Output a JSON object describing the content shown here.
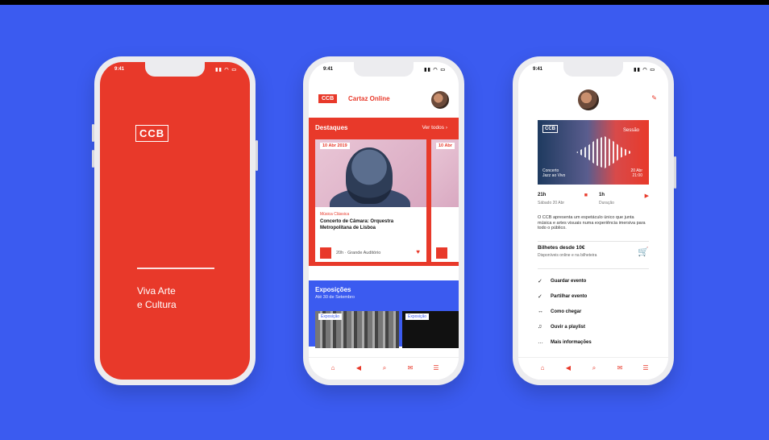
{
  "phone1": {
    "time": "9:41",
    "status_icons": "▮▮ ◠ ▭",
    "logo": "CCB",
    "tagline_line1": "Viva Arte",
    "tagline_line2": "e Cultura"
  },
  "phone2": {
    "time": "9:41",
    "status_icons": "▮▮ ◠ ▭",
    "logo": "CCB",
    "header_title": "Cartaz Online",
    "band_title": "Destaques",
    "band_link": "Ver todos ›",
    "card": {
      "date": "10 Abr 2019",
      "category": "Música Clássica",
      "title": "Concerto de Câmara: Orquestra Metropolitana de Lisboa",
      "footer": "20h · Grande Auditório",
      "heart": "♥"
    },
    "card2_date": "10 Abr",
    "blue_title": "Exposições",
    "blue_sub": "Até 30 de Setembro",
    "photo_tag": "Exposição",
    "photo_tag2": "Exposição",
    "tabs": [
      "⌂",
      "◀",
      "⌕",
      "✉",
      "☰"
    ]
  },
  "phone3": {
    "time": "9:41",
    "status_icons": "▮▮ ◠ ▭",
    "ticket_icon": "✎",
    "hero": {
      "logo": "CCB",
      "right": "Sessão",
      "bl": "Concerto\nJazz ao Vivo",
      "br": "20 Abr\n21:00"
    },
    "session1": {
      "label": "21h",
      "sub": "Sábado 20 Abr",
      "icon": "■"
    },
    "session2": {
      "label": "1h",
      "sub": "Duração",
      "icon": "▶"
    },
    "description": "O CCB apresenta um espetáculo único que junta música e artes visuais numa experiência imersiva para todo o público.",
    "ticket": {
      "title": "Bilhetes desde 10€",
      "sub": "Disponíveis online e na bilheteira",
      "cart": "🛒"
    },
    "menu": [
      {
        "icon": "✓",
        "label": "Guardar evento"
      },
      {
        "icon": "✓",
        "label": "Partilhar evento"
      },
      {
        "icon": "↔",
        "label": "Como chegar"
      },
      {
        "icon": "♫",
        "label": "Ouvir a playlist"
      },
      {
        "icon": "…",
        "label": "Mais informações"
      }
    ],
    "tabs": [
      "⌂",
      "◀",
      "⌕",
      "✉",
      "☰"
    ]
  }
}
